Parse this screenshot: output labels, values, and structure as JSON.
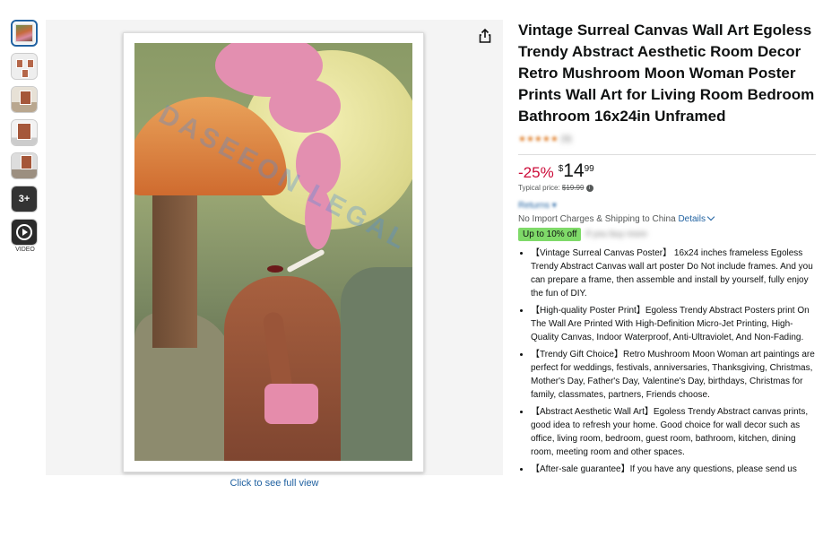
{
  "thumbnails": {
    "more_label": "3+",
    "video_label": "VIDEO"
  },
  "image_area": {
    "watermark_text": "DASEEON LEGAL",
    "full_view_link": "Click to see full view"
  },
  "product": {
    "title": "Vintage Surreal Canvas Wall Art Egoless Trendy Abstract Aesthetic Room Decor Retro Mushroom Moon Woman Poster Prints Wall Art for Living Room Bedroom Bathroom 16x24in Unframed",
    "rating_stars": "★★★★★",
    "rating_count": "(9)",
    "discount": "-25%",
    "currency": "$",
    "price_whole": "14",
    "price_fraction": "99",
    "typical_label": "Typical price:",
    "typical_price": "$19.99",
    "returns_text": "Returns ▾",
    "import_text": "No Import Charges & Shipping to China",
    "import_link": "Details",
    "promo_badge": "Up to 10% off",
    "promo_rest": "if you buy more"
  },
  "bullets": [
    "【Vintage Surreal Canvas Poster】 16x24 inches frameless Egoless Trendy Abstract Canvas wall art poster Do Not include frames. And you can prepare a frame, then assemble and install by yourself, fully enjoy the fun of DIY.",
    "【High-quality Poster Print】Egoless Trendy Abstract Posters print On The Wall Are Printed With High-Definition Micro-Jet Printing, High-Quality Canvas, Indoor Waterproof, Anti-Ultraviolet, And Non-Fading.",
    "【Trendy Gift Choice】Retro Mushroom Moon Woman art paintings are perfect for weddings, festivals, anniversaries, Thanksgiving, Christmas, Mother's Day, Father's Day, Valentine's Day, birthdays, Christmas for family, classmates, partners, Friends choose.",
    "【Abstract Aesthetic Wall Art】Egoless Trendy Abstract canvas prints, good idea to refresh your home. Good choice for wall decor such as office, living room, bedroom, guest room, bathroom, kitchen, dining room, meeting room and other spaces.",
    "【After-sale guarantee】If you have any questions, please send us"
  ],
  "colors": {
    "link": "#2162a1",
    "discount": "#cc0c39",
    "promo_badge": "#7fda69"
  }
}
